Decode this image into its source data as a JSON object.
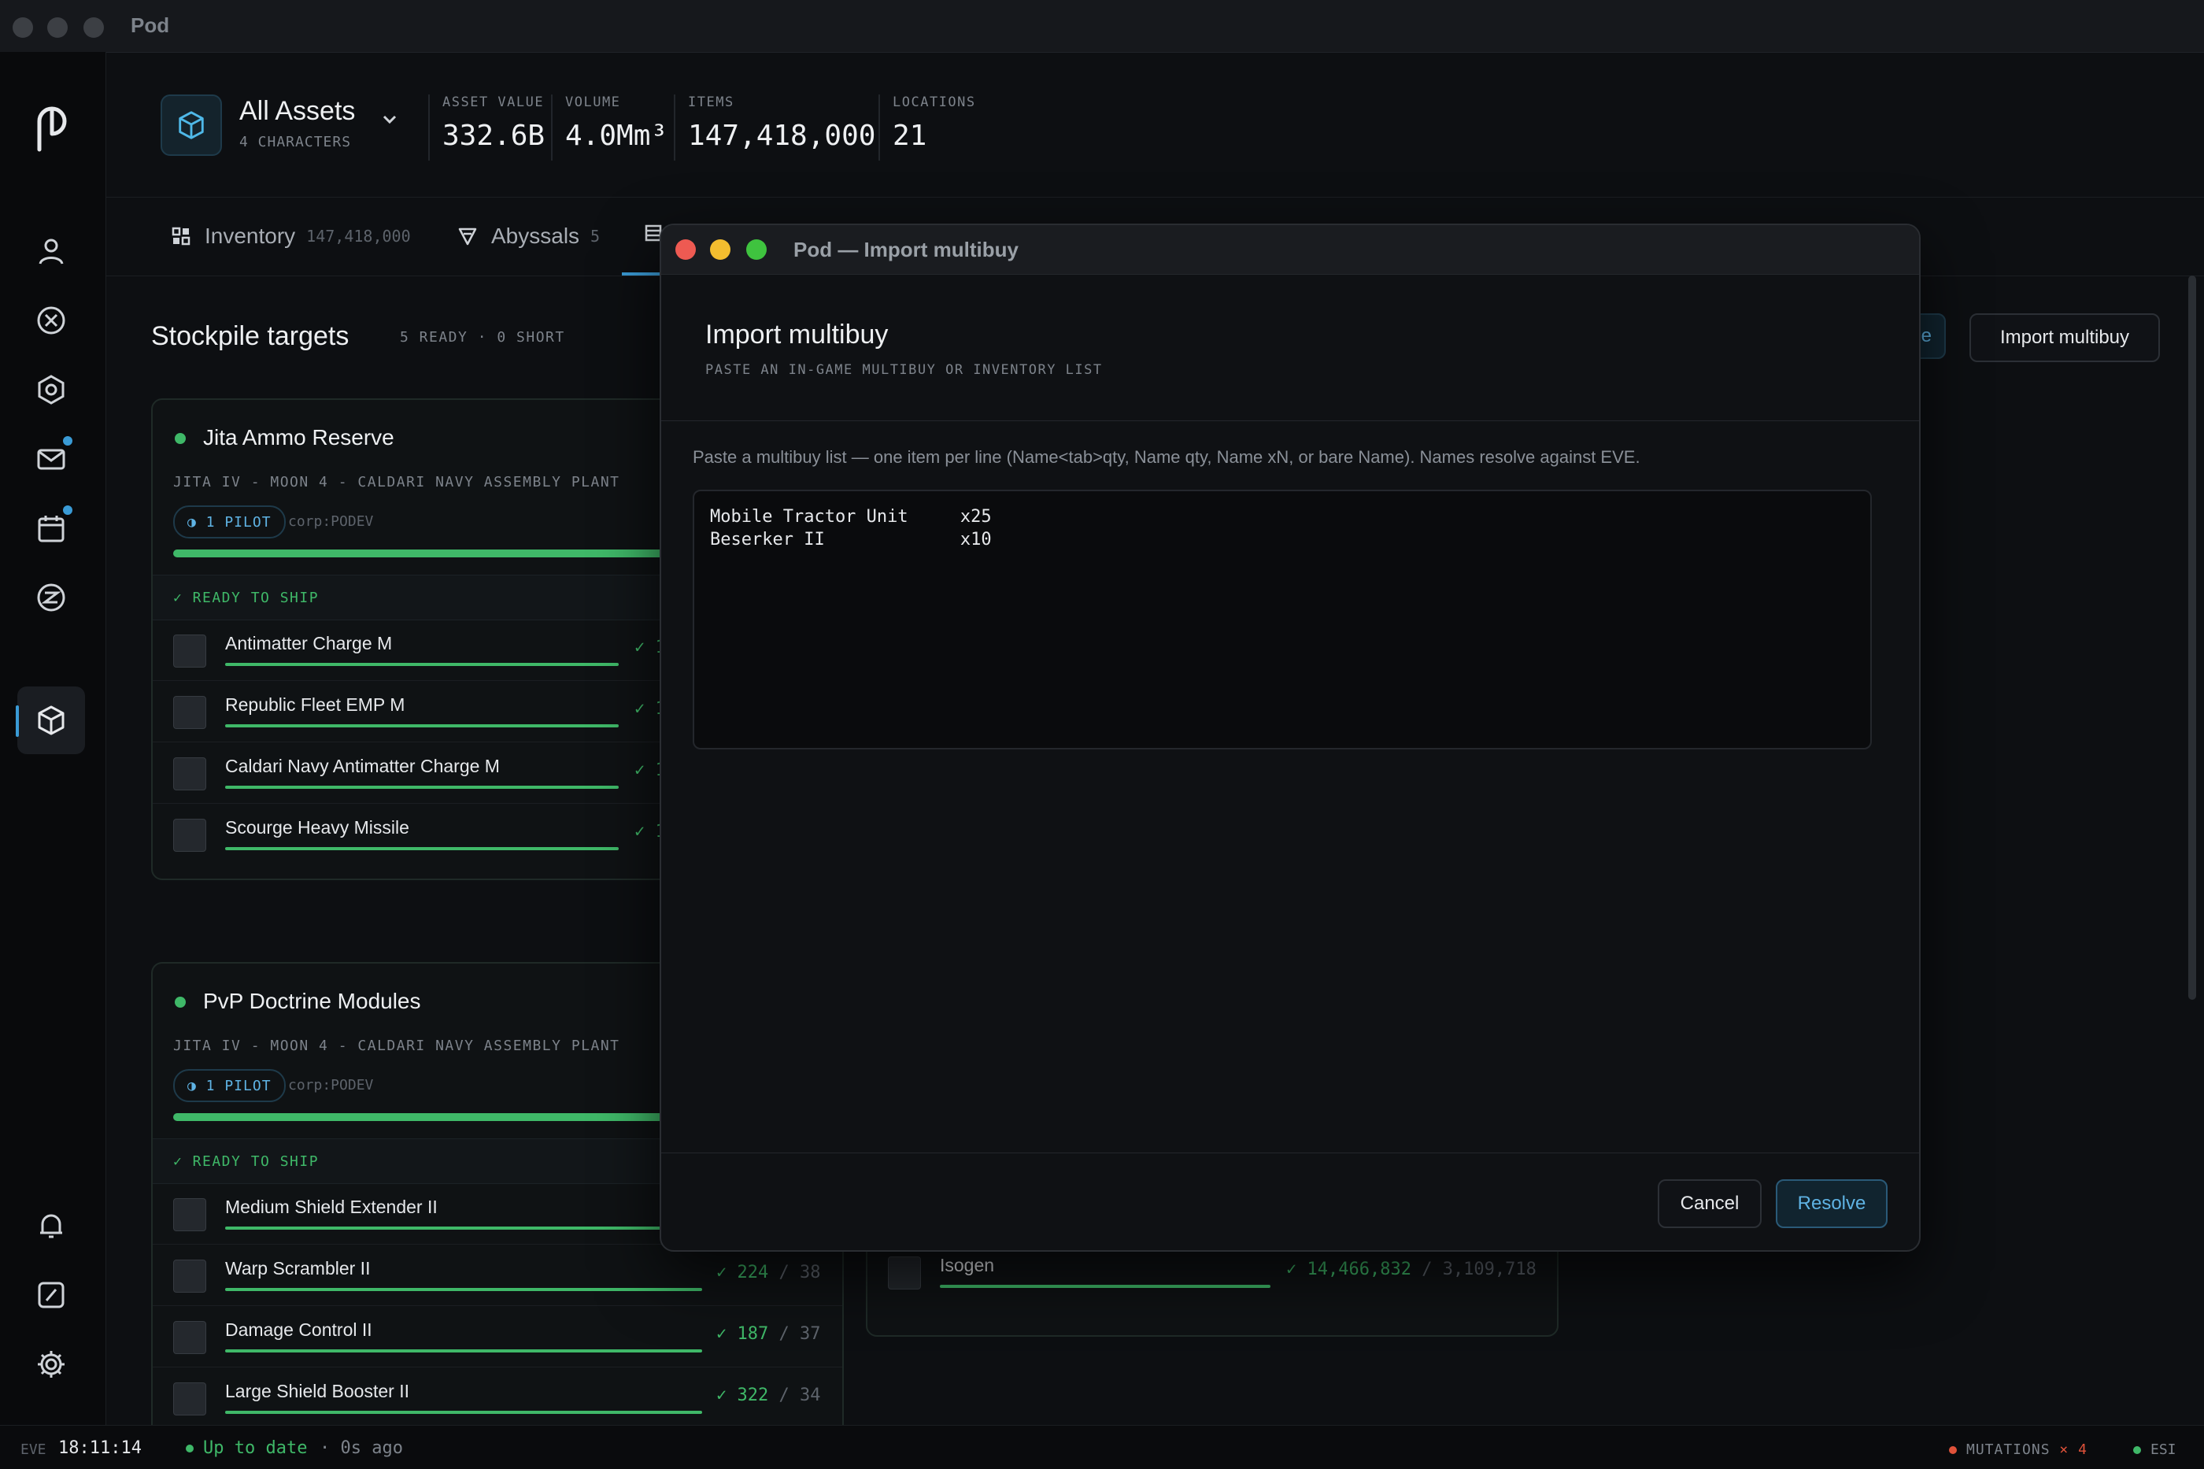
{
  "window": {
    "title": "Pod"
  },
  "rail": {
    "items": [
      "profile-icon",
      "close-circle-icon",
      "hex-settings-icon",
      "mail-icon",
      "calendar-icon",
      "exchange-icon",
      "cube-icon"
    ],
    "bottom": [
      "bell-icon",
      "clock-icon",
      "gear-icon"
    ],
    "accent": "#3a9bd6"
  },
  "header": {
    "title": "All Assets",
    "subtitle": "4 CHARACTERS",
    "stats": [
      {
        "label": "ASSET VALUE",
        "value": "332.6B"
      },
      {
        "label": "VOLUME",
        "value": "4.0Mm³"
      },
      {
        "label": "ITEMS",
        "value": "147,418,000"
      },
      {
        "label": "LOCATIONS",
        "value": "21"
      }
    ]
  },
  "tabs": [
    {
      "label": "Inventory",
      "count": "147,418,000"
    },
    {
      "label": "Abyssals",
      "count": "5"
    }
  ],
  "section": {
    "title": "Stockpile targets",
    "subtitle": "5 READY · 0 SHORT",
    "import_button": "Import multibuy",
    "partial_button": "e"
  },
  "cards": [
    {
      "name": "Jita Ammo Reserve",
      "location": "JITA IV - MOON 4 - CALDARI NAVY ASSEMBLY PLANT",
      "pilots": "◑ 1 PILOT",
      "corp": "corp:PODEV",
      "ready": "✓ READY TO SHIP",
      "rows": [
        {
          "name": "Antimatter Charge M",
          "check": "✓ 1"
        },
        {
          "name": "Republic Fleet EMP M",
          "check": "✓ 1"
        },
        {
          "name": "Caldari Navy Antimatter Charge M",
          "check": "✓ 1"
        },
        {
          "name": "Scourge Heavy Missile",
          "check": "✓ 1"
        }
      ]
    },
    {
      "name": "PvP Doctrine Modules",
      "location": "JITA IV - MOON 4 - CALDARI NAVY ASSEMBLY PLANT",
      "pilots": "◑ 1 PILOT",
      "corp": "corp:PODEV",
      "ready": "✓ READY TO SHIP",
      "rows": [
        {
          "name": "Medium Shield Extender II",
          "qty": "",
          "target": ""
        },
        {
          "name": "Warp Scrambler II",
          "qty": "✓ 224",
          "target": "/ 38"
        },
        {
          "name": "Damage Control II",
          "qty": "✓ 187",
          "target": "/ 37"
        },
        {
          "name": "Large Shield Booster II",
          "qty": "✓ 322",
          "target": "/ 34"
        }
      ]
    }
  ],
  "card2_row": {
    "name": "Isogen",
    "qty": "✓ 14,466,832",
    "target": "/ 3,109,718"
  },
  "statusbar": {
    "eve_label": "EVE",
    "time": "18:11:14",
    "status": "Up to date",
    "ago": "· 0s ago",
    "mutations_label": "MUTATIONS",
    "mutations_count": "× 4",
    "esi": "ESI"
  },
  "modal": {
    "window_title": "Pod — Import multibuy",
    "title": "Import multibuy",
    "subtitle": "PASTE AN IN-GAME MULTIBUY OR INVENTORY LIST",
    "hint": "Paste a multibuy list — one item per line (Name<tab>qty, Name qty, Name xN, or bare Name). Names resolve against EVE.",
    "paste_value": "Mobile Tractor Unit     x25\nBeserker II             x10",
    "cancel": "Cancel",
    "resolve": "Resolve"
  }
}
